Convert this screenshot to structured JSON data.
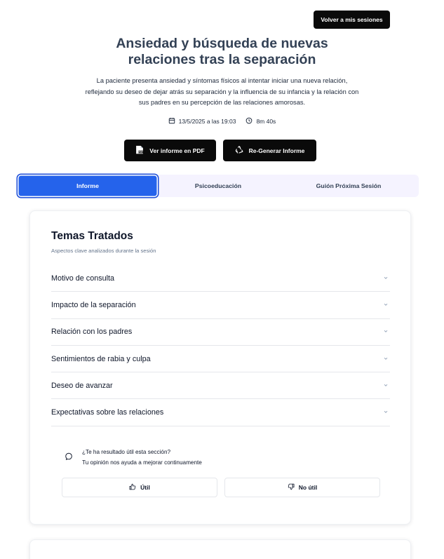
{
  "header": {
    "back_label": "Volver a mis sesiones",
    "title": "Ansiedad y búsqueda de nuevas relaciones tras la separación",
    "summary": "La paciente presenta ansiedad y síntomas físicos al intentar iniciar una nueva relación, reflejando su deseo de dejar atrás su separación y la influencia de su infancia y la relación con sus padres en su percepción de las relaciones amorosas.",
    "date": "13/5/2025 a las 19:03",
    "duration": "8m 40s"
  },
  "actions": {
    "pdf_label": "Ver informe en PDF",
    "regen_label": "Re-Generar Informe"
  },
  "tabs": [
    {
      "label": "Informe",
      "active": true
    },
    {
      "label": "Psicoeducación",
      "active": false
    },
    {
      "label": "Guión Próxima Sesión",
      "active": false
    }
  ],
  "card": {
    "title": "Temas Tratados",
    "subtitle": "Aspectos clave analizados durante la sesión",
    "topics": [
      "Motivo de consulta",
      "Impacto de la separación",
      "Relación con los padres",
      "Sentimientos de rabia y culpa",
      "Deseo de avanzar",
      "Expectativas sobre las relaciones"
    ]
  },
  "feedback": {
    "question": "¿Te ha resultado útil esta sección?",
    "subtitle": "Tu opinión nos ayuda a mejorar continuamente",
    "yes_label": "Útil",
    "no_label": "No útil"
  },
  "colors": {
    "accent": "#2563eb",
    "tab_bg": "#f5f3ff",
    "dark_button": "#0a0a0a"
  }
}
